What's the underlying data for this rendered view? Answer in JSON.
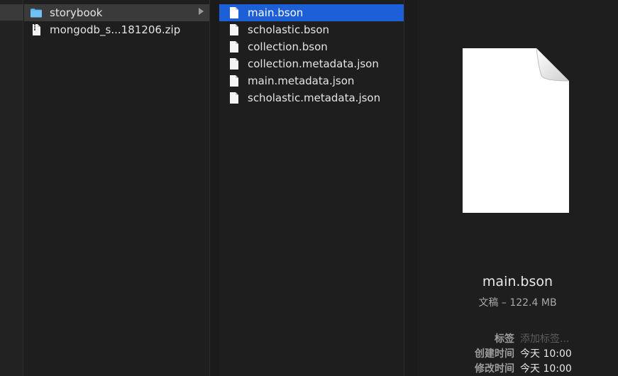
{
  "column1": {
    "items": [
      {
        "label": "storybook",
        "icon": "folder-icon",
        "selected": true
      },
      {
        "label": "mongodb_s...181206.zip",
        "icon": "zip-file-icon",
        "selected": false
      }
    ]
  },
  "column2": {
    "items": [
      {
        "label": "main.bson",
        "selected": true
      },
      {
        "label": "scholastic.bson",
        "selected": false
      },
      {
        "label": "collection.bson",
        "selected": false
      },
      {
        "label": "collection.metadata.json",
        "selected": false
      },
      {
        "label": "main.metadata.json",
        "selected": false
      },
      {
        "label": "scholastic.metadata.json",
        "selected": false
      }
    ]
  },
  "preview": {
    "name": "main.bson",
    "kind": "文稿 – 122.4 MB",
    "tags_label": "标签",
    "tags_placeholder": "添加标签...",
    "created_label": "创建时间",
    "created_value": "今天 10:00",
    "modified_label": "修改时间",
    "modified_value": "今天 10:00"
  },
  "colors": {
    "selection_blue": "#1d5fd6",
    "selection_gray": "#3a3a3a",
    "folder_blue": "#5fb6f0",
    "background": "#1e1e1e"
  }
}
